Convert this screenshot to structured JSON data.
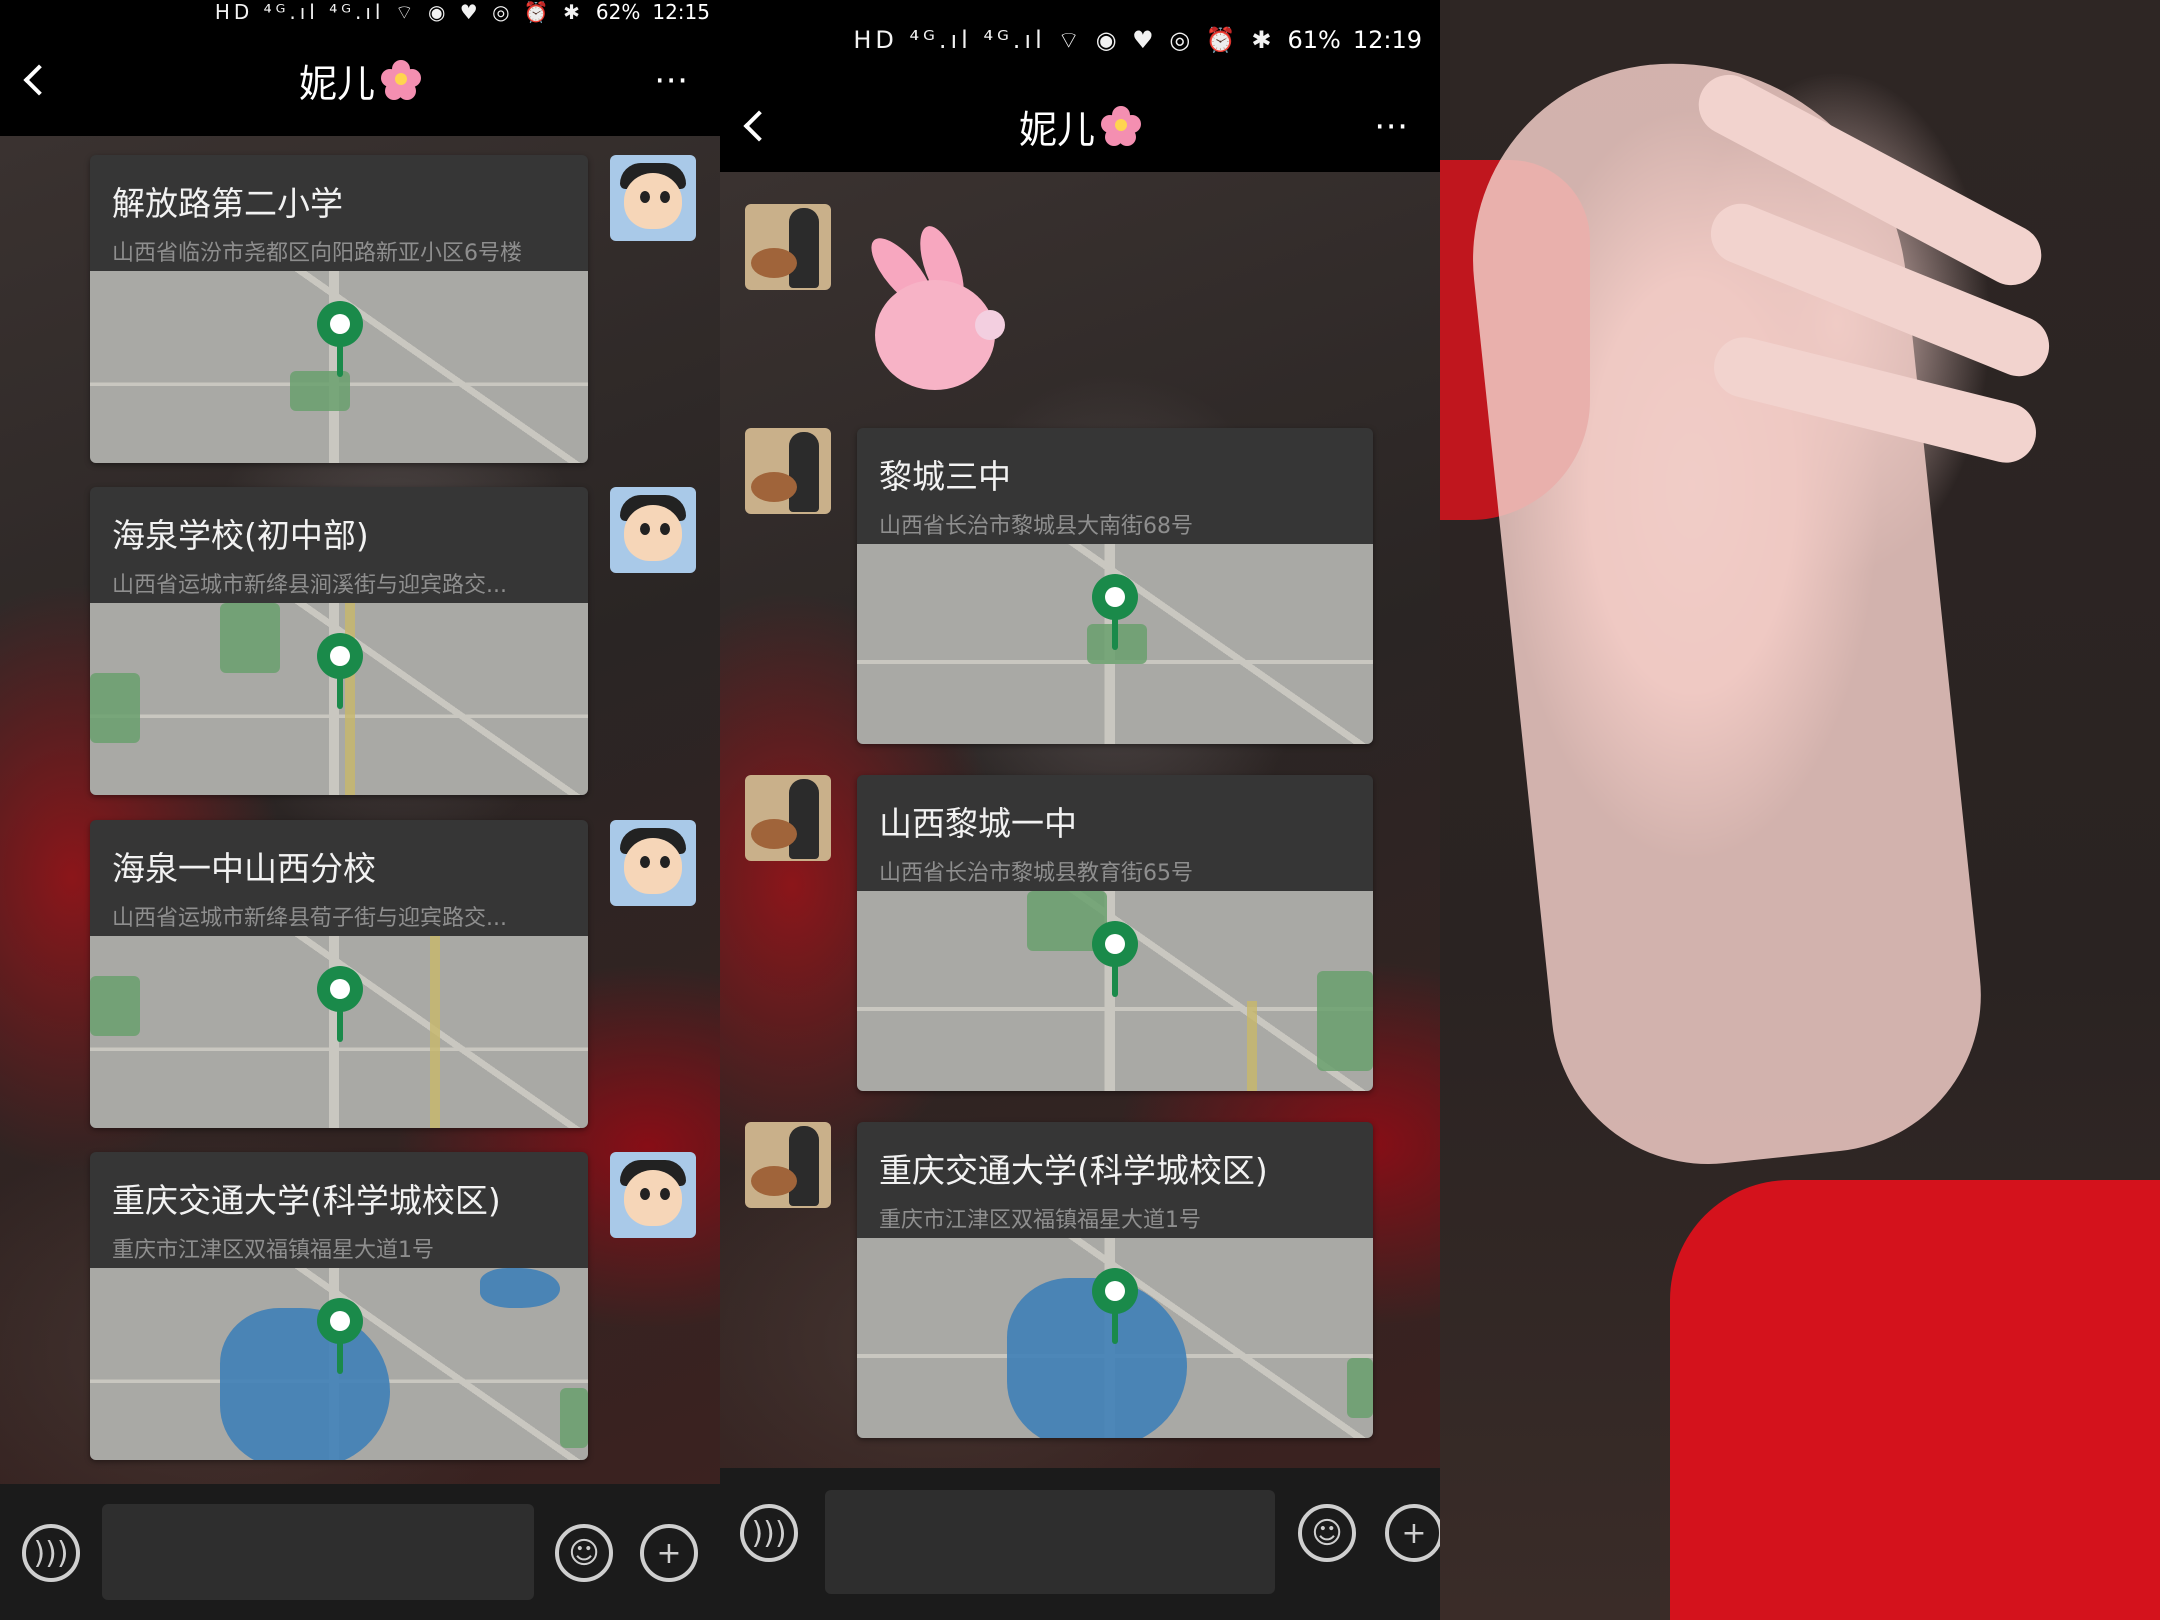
{
  "left": {
    "status": {
      "icons": "HD ⁴ᴳ.ıl ⁴ᴳ.ıl ⌔ ◉ ♥ ◎ ⏰ ✱",
      "battery": "62%",
      "time": "12:15"
    },
    "title": "妮儿",
    "messages": [
      {
        "title": "解放路第二小学",
        "address": "山西省临汾市尧都区向阳路新亚小区6号楼"
      },
      {
        "title": "海泉学校(初中部)",
        "address": "山西省运城市新绛县涧溪街与迎宾路交..."
      },
      {
        "title": "海泉一中山西分校",
        "address": "山西省运城市新绛县荀子街与迎宾路交..."
      },
      {
        "title": "重庆交通大学(科学城校区)",
        "address": "重庆市江津区双福镇福星大道1号"
      }
    ]
  },
  "right": {
    "status": {
      "icons": "HD ⁴ᴳ.ıl ⁴ᴳ.ıl ⌔ ◉ ♥ ◎ ⏰ ✱",
      "battery": "61%",
      "time": "12:19"
    },
    "title": "妮儿",
    "messages": [
      {
        "title": "黎城三中",
        "address": "山西省长治市黎城县大南街68号"
      },
      {
        "title": "山西黎城一中",
        "address": "山西省长治市黎城县教育街65号"
      },
      {
        "title": "重庆交通大学(科学城校区)",
        "address": "重庆市江津区双福镇福星大道1号"
      }
    ]
  },
  "icons": {
    "back": "chevron-left",
    "more": "⋯",
    "voice": "🔊",
    "emoji": "☺",
    "plus": "+",
    "flower": "flower-icon",
    "pin": "map-pin"
  },
  "colors": {
    "bar": "#000000",
    "bubble": "#363636",
    "pin": "#1a8a4a",
    "input": "#2e2e2e"
  }
}
